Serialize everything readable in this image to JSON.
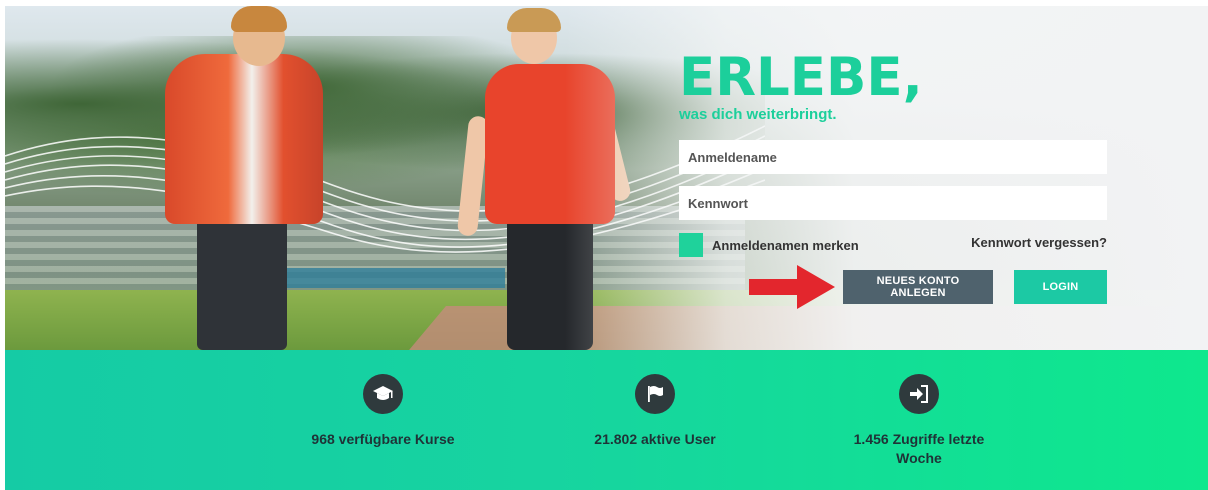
{
  "hero": {
    "headline": "ERLEBE,",
    "subline": "was dich weiterbringt."
  },
  "login_form": {
    "username_placeholder": "Anmeldename",
    "password_placeholder": "Kennwort",
    "remember_label": "Anmeldenamen merken",
    "forgot_label": "Kennwort vergessen?",
    "new_account_label": "NEUES KONTO ANLEGEN",
    "login_label": "LOGIN"
  },
  "stats": [
    {
      "icon": "graduation-cap-icon",
      "text": "968 verfügbare Kurse"
    },
    {
      "icon": "flag-icon",
      "text": "21.802 aktive User"
    },
    {
      "icon": "sign-in-icon",
      "text": "1.456 Zugriffe letzte Woche"
    }
  ],
  "colors": {
    "accent": "#1ccf9b",
    "secondary_button": "#4f626d",
    "login_button": "#1cc9a4",
    "arrow": "#e3262d",
    "icon_circle": "#2f3a3d"
  }
}
